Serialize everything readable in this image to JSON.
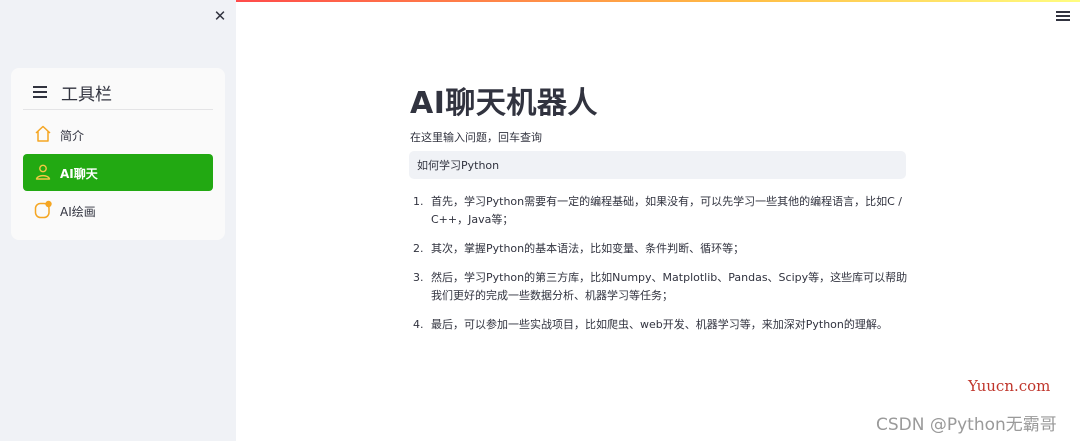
{
  "sidebar": {
    "close_icon": "close-icon",
    "menu": {
      "title": "工具栏",
      "items": [
        {
          "label": "简介",
          "icon": "house-icon",
          "active": false
        },
        {
          "label": "AI聊天",
          "icon": "person-icon",
          "active": true
        },
        {
          "label": "AI绘画",
          "icon": "palette-icon",
          "active": false
        }
      ]
    }
  },
  "main": {
    "title": "AI聊天机器人",
    "input_label": "在这里输入问题，回车查询",
    "input_value": "如何学习Python",
    "answers": [
      {
        "num": "1.",
        "text": "首先，学习Python需要有一定的编程基础，如果没有，可以先学习一些其他的编程语言，比如C / C++，Java等；"
      },
      {
        "num": "2.",
        "text": "其次，掌握Python的基本语法，比如变量、条件判断、循环等；"
      },
      {
        "num": "3.",
        "text": "然后，学习Python的第三方库，比如Numpy、Matplotlib、Pandas、Scipy等，这些库可以帮助我们更好的完成一些数据分析、机器学习等任务；"
      },
      {
        "num": "4.",
        "text": "最后，可以参加一些实战项目，比如爬虫、web开发、机器学习等，来加深对Python的理解。"
      }
    ]
  },
  "watermarks": {
    "yuucn": "Yuucn.com",
    "csdn": "CSDN @Python无霸哥"
  },
  "colors": {
    "active_item": "#22a912",
    "icon_orange": "#f5a623",
    "sidebar_bg": "#f0f2f6",
    "text": "#31333f"
  }
}
